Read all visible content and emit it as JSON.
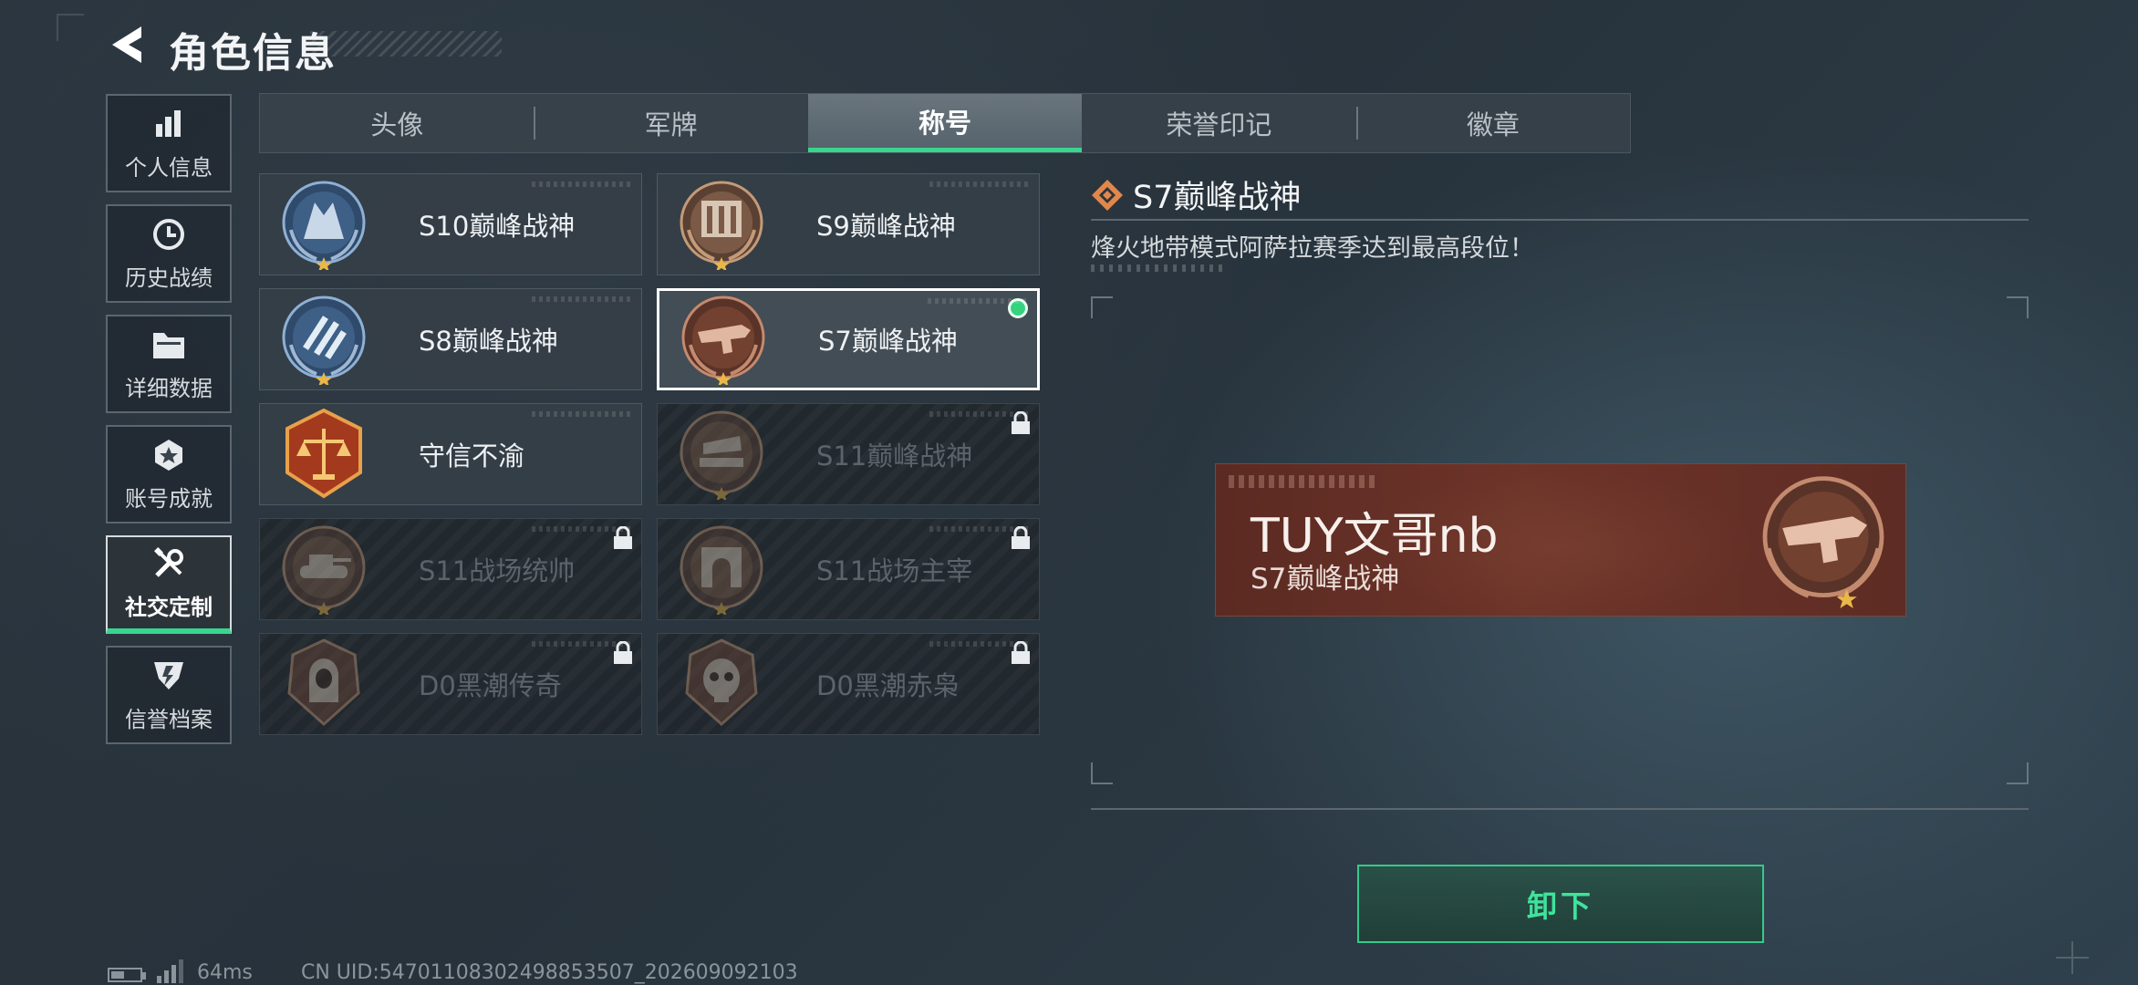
{
  "header": {
    "title": "角色信息",
    "back_icon": "chevron-left-icon"
  },
  "nav": [
    {
      "label": "个人信息",
      "icon": "bar-chart-icon",
      "active": false
    },
    {
      "label": "历史战绩",
      "icon": "clock-icon",
      "active": false
    },
    {
      "label": "详细数据",
      "icon": "folder-icon",
      "active": false
    },
    {
      "label": "账号成就",
      "icon": "badge-icon",
      "active": false
    },
    {
      "label": "社交定制",
      "icon": "tools-icon",
      "active": true
    },
    {
      "label": "信誉档案",
      "icon": "shield-emblem-icon",
      "active": false
    }
  ],
  "tabs": [
    {
      "label": "头像",
      "active": false
    },
    {
      "label": "军牌",
      "active": false
    },
    {
      "label": "称号",
      "active": true
    },
    {
      "label": "荣誉印记",
      "active": false
    },
    {
      "label": "徽章",
      "active": false
    }
  ],
  "titles": [
    {
      "name": "S10巅峰战神",
      "emblem": "blue-laurel-emblem",
      "locked": false,
      "selected": false
    },
    {
      "name": "S9巅峰战神",
      "emblem": "bronze-building-emblem",
      "locked": false,
      "selected": false
    },
    {
      "name": "S8巅峰战神",
      "emblem": "blue-stripes-emblem",
      "locked": false,
      "selected": false
    },
    {
      "name": "S7巅峰战神",
      "emblem": "bronze-gun-emblem",
      "locked": false,
      "selected": true
    },
    {
      "name": "守信不渝",
      "emblem": "scales-emblem",
      "locked": false,
      "selected": false
    },
    {
      "name": "S11巅峰战神",
      "emblem": "bronze-pedestal-emblem",
      "locked": true,
      "selected": false
    },
    {
      "name": "S11战场统帅",
      "emblem": "tank-emblem",
      "locked": true,
      "selected": false
    },
    {
      "name": "S11战场主宰",
      "emblem": "arch-emblem",
      "locked": true,
      "selected": false
    },
    {
      "name": "D0黑潮传奇",
      "emblem": "hooded-figure-emblem",
      "locked": true,
      "selected": false
    },
    {
      "name": "D0黑潮赤枭",
      "emblem": "skull-emblem",
      "locked": true,
      "selected": false
    }
  ],
  "detail": {
    "title": "S7巅峰战神",
    "description": "烽火地带模式阿萨拉赛季达到最高段位！",
    "preview": {
      "player_name": "TUY文哥nb",
      "title": "S7巅峰战神"
    },
    "unequip_label": "卸下"
  },
  "status": {
    "ping": "64ms",
    "uid": "CN UID:5470110830249885350​7_202609092103"
  },
  "colors": {
    "accent": "#39d58f",
    "banner": "#6d3429",
    "background": "#2b353e"
  }
}
